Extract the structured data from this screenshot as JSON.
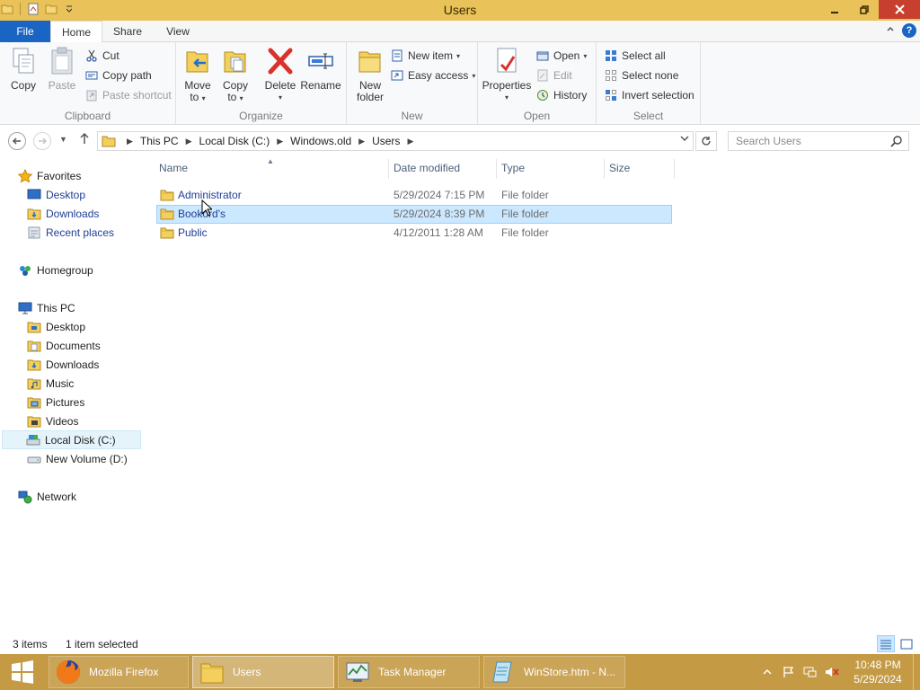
{
  "window": {
    "title": "Users"
  },
  "ribbon": {
    "tabs": [
      "File",
      "Home",
      "Share",
      "View"
    ],
    "active_tab": "Home",
    "clipboard": {
      "label": "Clipboard",
      "copy": "Copy",
      "paste": "Paste",
      "cut": "Cut",
      "copy_path": "Copy path",
      "paste_shortcut": "Paste shortcut"
    },
    "organize": {
      "label": "Organize",
      "move_to": [
        "Move",
        "to"
      ],
      "copy_to": [
        "Copy",
        "to"
      ],
      "delete": "Delete",
      "rename": "Rename"
    },
    "new": {
      "label": "New",
      "new_folder": [
        "New",
        "folder"
      ],
      "new_item": "New item",
      "easy_access": "Easy access"
    },
    "open": {
      "label": "Open",
      "properties": "Properties",
      "open": "Open",
      "edit": "Edit",
      "history": "History"
    },
    "select": {
      "label": "Select",
      "select_all": "Select all",
      "select_none": "Select none",
      "invert_selection": "Invert selection"
    }
  },
  "address": {
    "crumbs": [
      "This PC",
      "Local Disk (C:)",
      "Windows.old",
      "Users"
    ],
    "search_placeholder": "Search Users"
  },
  "nav": {
    "favorites": {
      "label": "Favorites",
      "items": [
        "Desktop",
        "Downloads",
        "Recent places"
      ]
    },
    "homegroup": "Homegroup",
    "this_pc": {
      "label": "This PC",
      "items": [
        "Desktop",
        "Documents",
        "Downloads",
        "Music",
        "Pictures",
        "Videos",
        "Local Disk (C:)",
        "New Volume (D:)"
      ]
    },
    "network": "Network"
  },
  "columns": [
    "Name",
    "Date modified",
    "Type",
    "Size"
  ],
  "files": [
    {
      "name": "Administrator",
      "date": "5/29/2024 7:15 PM",
      "type": "File folder",
      "size": ""
    },
    {
      "name": "Bookord's",
      "date": "5/29/2024 8:39 PM",
      "type": "File folder",
      "size": ""
    },
    {
      "name": "Public",
      "date": "4/12/2011 1:28 AM",
      "type": "File folder",
      "size": ""
    }
  ],
  "status": {
    "count": "3 items",
    "selection": "1 item selected"
  },
  "taskbar": {
    "items": [
      {
        "label": "Mozilla Firefox",
        "icon": "firefox-icon"
      },
      {
        "label": "Users",
        "icon": "folder-icon",
        "active": true
      },
      {
        "label": "Task Manager",
        "icon": "task-manager-icon"
      },
      {
        "label": "WinStore.htm - N...",
        "icon": "notepad-icon"
      }
    ],
    "time": "10:48 PM",
    "date": "5/29/2024"
  },
  "colors": {
    "title_bar": "#e9c259",
    "taskbar": "#c49a45",
    "file_tab": "#1a64c4",
    "selection": "#cce8ff",
    "close": "#c7402f"
  }
}
